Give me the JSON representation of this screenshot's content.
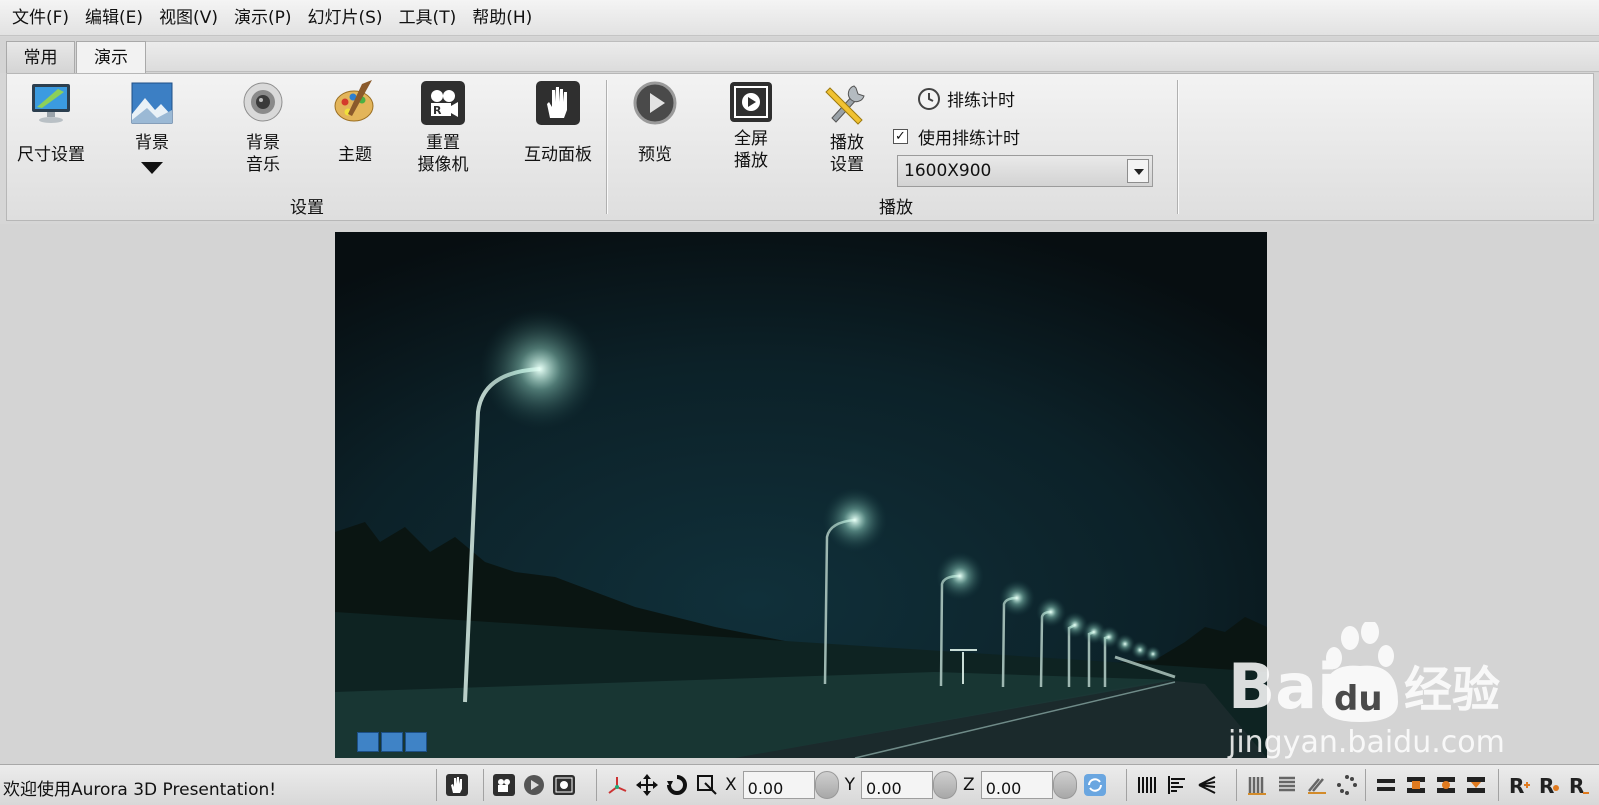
{
  "menu": [
    "文件(F)",
    "编辑(E)",
    "视图(V)",
    "演示(P)",
    "幻灯片(S)",
    "工具(T)",
    "帮助(H)"
  ],
  "tabs": [
    {
      "label": "常用",
      "active": false
    },
    {
      "label": "演示",
      "active": true
    }
  ],
  "ribbon": {
    "setup_group": {
      "label": "设置",
      "buttons": {
        "size": "尺寸设置",
        "background": "背景",
        "bg_music_line1": "背景",
        "bg_music_line2": "音乐",
        "theme": "主题",
        "reset_line1": "重置",
        "reset_line2": "摄像机",
        "panel": "互动面板"
      }
    },
    "play_group": {
      "label": "播放",
      "buttons": {
        "preview": "预览",
        "fullscreen_line1": "全屏",
        "fullscreen_line2": "播放",
        "settings_line1": "播放",
        "settings_line2": "设置"
      },
      "rehearse": "排练计时",
      "use_rehearse": "使用排练计时",
      "use_rehearse_checked": true,
      "resolution": "1600X900"
    }
  },
  "statusbar": {
    "message": "欢迎使用Aurora 3D Presentation!",
    "x_label": "X",
    "x_value": "0.00",
    "y_label": "Y",
    "y_value": "0.00",
    "z_label": "Z",
    "z_value": "0.00"
  },
  "watermark": {
    "brand_a": "Bai",
    "brand_b": "du",
    "brand_c": "经验",
    "url": "jingyan.baidu.com"
  },
  "colors": {
    "accent_blue": "#3f83c6",
    "slide_sky": "#0f2a32",
    "lamp_glow": "#e8fff6"
  }
}
